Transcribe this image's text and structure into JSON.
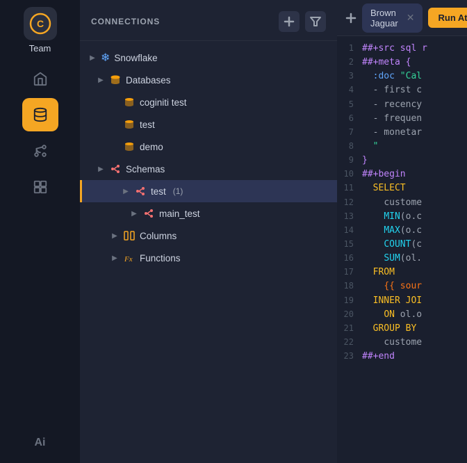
{
  "sidebar": {
    "logo": "C",
    "team_label": "Team",
    "nav_items": [
      {
        "id": "home",
        "icon": "home",
        "active": false
      },
      {
        "id": "database",
        "icon": "database",
        "active": true
      },
      {
        "id": "branches",
        "icon": "branches",
        "active": false
      },
      {
        "id": "packages",
        "icon": "packages",
        "active": false
      }
    ],
    "ai_label": "Ai"
  },
  "connections": {
    "title": "CONNECTIONS",
    "add_btn": "+",
    "filter_btn": "filter",
    "tree": [
      {
        "id": "snowflake",
        "label": "Snowflake",
        "level": 0,
        "type": "snowflake",
        "expandable": true,
        "expanded": true
      },
      {
        "id": "databases",
        "label": "Databases",
        "level": 1,
        "type": "database",
        "expandable": true,
        "expanded": true
      },
      {
        "id": "coginiti_test",
        "label": "coginiti test",
        "level": 2,
        "type": "db_instance",
        "expandable": false
      },
      {
        "id": "test_db",
        "label": "test",
        "level": 2,
        "type": "db_instance",
        "expandable": false
      },
      {
        "id": "demo",
        "label": "demo",
        "level": 2,
        "type": "db_instance",
        "expandable": false
      },
      {
        "id": "schemas",
        "label": "Schemas",
        "level": 1,
        "type": "schema_group",
        "expandable": true,
        "expanded": true
      },
      {
        "id": "test_schema",
        "label": "test",
        "level": 2,
        "type": "schema",
        "expandable": true,
        "active": true,
        "badge": "(1)"
      },
      {
        "id": "main_test",
        "label": "main_test",
        "level": 3,
        "type": "schema_sub",
        "expandable": true
      },
      {
        "id": "columns",
        "label": "Columns",
        "level": 2,
        "type": "columns",
        "expandable": true
      },
      {
        "id": "functions",
        "label": "Functions",
        "level": 2,
        "type": "functions",
        "expandable": true
      }
    ]
  },
  "editor": {
    "tab_name": "Brown Jaguar",
    "run_btn_label": "Run At Cursor",
    "code_lines": [
      {
        "num": 1,
        "content": "##+src sql r"
      },
      {
        "num": 2,
        "content": "##+meta {"
      },
      {
        "num": 3,
        "content": "  :doc \"Cal"
      },
      {
        "num": 4,
        "content": "  - first c"
      },
      {
        "num": 5,
        "content": "  - recency"
      },
      {
        "num": 6,
        "content": "  - frequen"
      },
      {
        "num": 7,
        "content": "  - monetar"
      },
      {
        "num": 8,
        "content": "  \""
      },
      {
        "num": 9,
        "content": "}"
      },
      {
        "num": 10,
        "content": "##+begin"
      },
      {
        "num": 11,
        "content": "  SELECT"
      },
      {
        "num": 12,
        "content": "    custome"
      },
      {
        "num": 13,
        "content": "    MIN(o.c"
      },
      {
        "num": 14,
        "content": "    MAX(o.c"
      },
      {
        "num": 15,
        "content": "    COUNT(c"
      },
      {
        "num": 16,
        "content": "    SUM(ol."
      },
      {
        "num": 17,
        "content": "  FROM"
      },
      {
        "num": 18,
        "content": "    {{ sour"
      },
      {
        "num": 19,
        "content": "  INNER JOI"
      },
      {
        "num": 20,
        "content": "    ON ol.o"
      },
      {
        "num": 21,
        "content": "  GROUP BY"
      },
      {
        "num": 22,
        "content": "    custome"
      },
      {
        "num": 23,
        "content": "##+end"
      }
    ]
  }
}
